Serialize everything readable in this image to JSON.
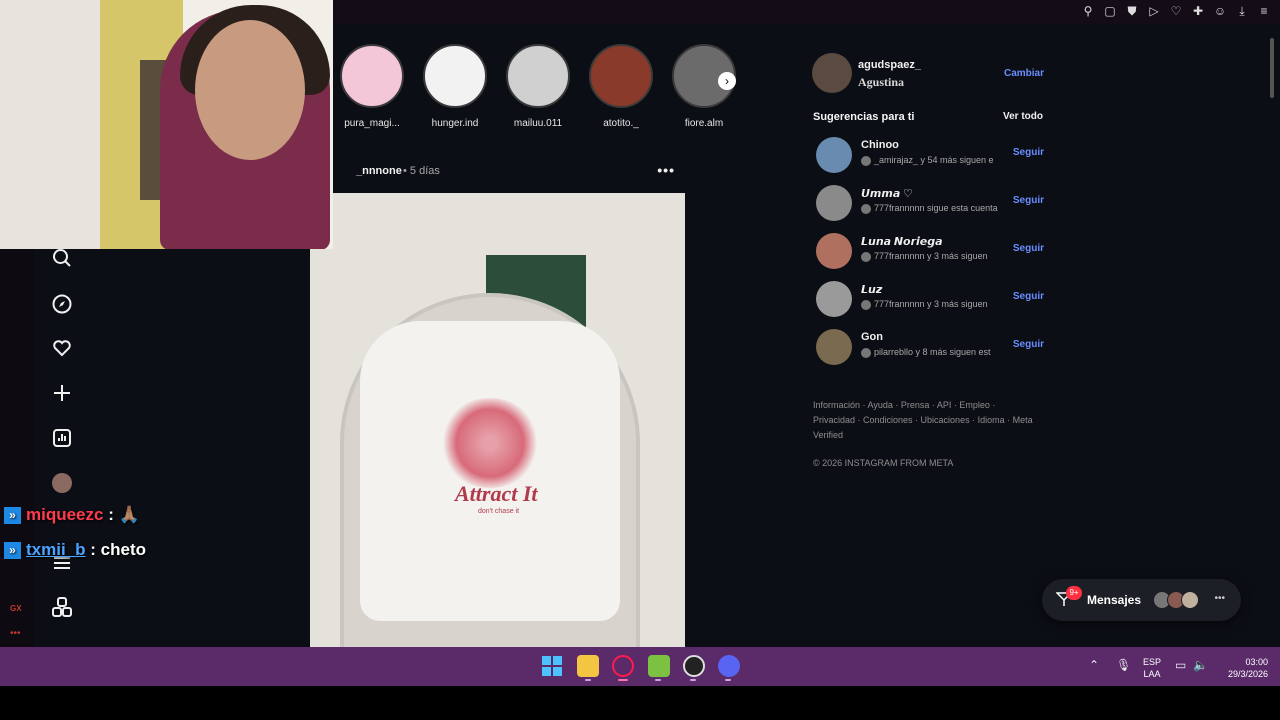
{
  "stories": [
    {
      "label": "pura_magi...",
      "color": "#f3c6d8"
    },
    {
      "label": "hunger.ind",
      "color": "#f2f2f2"
    },
    {
      "label": "mailuu.011",
      "color": "#d0d0d0"
    },
    {
      "label": "atotito._",
      "color": "#8a3a2a"
    },
    {
      "label": "fiore.alm",
      "color": "#6b6b6b"
    }
  ],
  "post": {
    "username": "_nnnone",
    "time": "• 5 días",
    "image_text": "Attract It",
    "image_subtext": "don't chase it"
  },
  "chat": [
    {
      "user": "miqueezc",
      "sep": " :",
      "message": " 🙏🏽",
      "color": "#ff3b4e"
    },
    {
      "user": "txmii_b",
      "sep": " :",
      "message": " cheto",
      "color": "#4aa3ff"
    }
  ],
  "profile": {
    "username": "agudspaez_",
    "name": "Agustina",
    "switch_label": "Cambiar"
  },
  "suggestions": {
    "heading": "Sugerencias para ti",
    "see_all": "Ver todo",
    "follow_label": "Seguir",
    "items": [
      {
        "name": "Chinoo",
        "sub": "_amirajaz_ y 54 más siguen e",
        "fancy": false,
        "color": "#6a8bb0"
      },
      {
        "name": "𝙐𝙢𝙢𝙖 ♡",
        "sub": "777frannnnn sigue esta cuenta",
        "fancy": true,
        "color": "#8a8a8a"
      },
      {
        "name": "𝙇𝙪𝙣𝙖 𝙉𝙤𝙧𝙞𝙚𝙜𝙖",
        "sub": "777frannnnn y 3 más siguen",
        "fancy": true,
        "color": "#b07060"
      },
      {
        "name": "𝙇𝙪𝙯",
        "sub": "777frannnnn y 3 más siguen",
        "fancy": true,
        "color": "#9a9a9a"
      },
      {
        "name": "Gon",
        "sub": "pilarrebllo y 8 más siguen est",
        "fancy": false,
        "color": "#7a6a50"
      }
    ]
  },
  "footer": {
    "links": "Información · Ayuda · Prensa · API · Empleo · Privacidad · Condiciones · Ubicaciones · Idioma · Meta Verified",
    "copyright": "© 2026 INSTAGRAM FROM META"
  },
  "messages": {
    "label": "Mensajes",
    "badge": "9+"
  },
  "gx": {
    "label": "GX",
    "dots": "•••"
  },
  "taskbar": {
    "lang_line1": "ESP",
    "lang_line2": "LAA",
    "time": "03:00",
    "date": "29/3/2026"
  },
  "colors": {
    "accent_link": "#6a8dff",
    "taskbar": "#5a2a69",
    "background": "#0b0e14"
  }
}
